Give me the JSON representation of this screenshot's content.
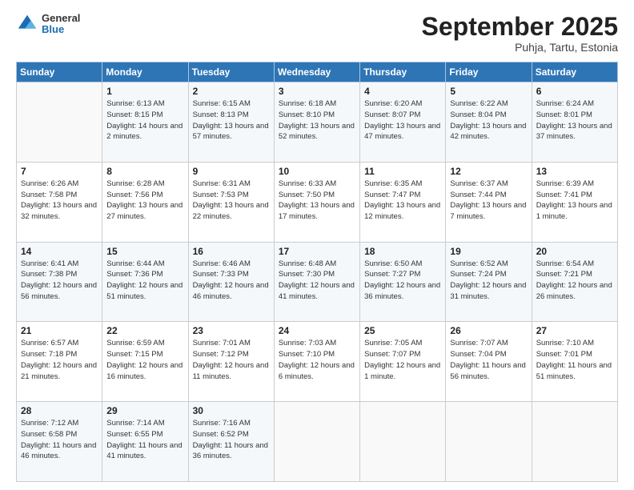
{
  "header": {
    "logo_general": "General",
    "logo_blue": "Blue",
    "month": "September 2025",
    "location": "Puhja, Tartu, Estonia"
  },
  "days_of_week": [
    "Sunday",
    "Monday",
    "Tuesday",
    "Wednesday",
    "Thursday",
    "Friday",
    "Saturday"
  ],
  "weeks": [
    [
      {
        "day": "",
        "sunrise": "",
        "sunset": "",
        "daylight": ""
      },
      {
        "day": "1",
        "sunrise": "Sunrise: 6:13 AM",
        "sunset": "Sunset: 8:15 PM",
        "daylight": "Daylight: 14 hours and 2 minutes."
      },
      {
        "day": "2",
        "sunrise": "Sunrise: 6:15 AM",
        "sunset": "Sunset: 8:13 PM",
        "daylight": "Daylight: 13 hours and 57 minutes."
      },
      {
        "day": "3",
        "sunrise": "Sunrise: 6:18 AM",
        "sunset": "Sunset: 8:10 PM",
        "daylight": "Daylight: 13 hours and 52 minutes."
      },
      {
        "day": "4",
        "sunrise": "Sunrise: 6:20 AM",
        "sunset": "Sunset: 8:07 PM",
        "daylight": "Daylight: 13 hours and 47 minutes."
      },
      {
        "day": "5",
        "sunrise": "Sunrise: 6:22 AM",
        "sunset": "Sunset: 8:04 PM",
        "daylight": "Daylight: 13 hours and 42 minutes."
      },
      {
        "day": "6",
        "sunrise": "Sunrise: 6:24 AM",
        "sunset": "Sunset: 8:01 PM",
        "daylight": "Daylight: 13 hours and 37 minutes."
      }
    ],
    [
      {
        "day": "7",
        "sunrise": "Sunrise: 6:26 AM",
        "sunset": "Sunset: 7:58 PM",
        "daylight": "Daylight: 13 hours and 32 minutes."
      },
      {
        "day": "8",
        "sunrise": "Sunrise: 6:28 AM",
        "sunset": "Sunset: 7:56 PM",
        "daylight": "Daylight: 13 hours and 27 minutes."
      },
      {
        "day": "9",
        "sunrise": "Sunrise: 6:31 AM",
        "sunset": "Sunset: 7:53 PM",
        "daylight": "Daylight: 13 hours and 22 minutes."
      },
      {
        "day": "10",
        "sunrise": "Sunrise: 6:33 AM",
        "sunset": "Sunset: 7:50 PM",
        "daylight": "Daylight: 13 hours and 17 minutes."
      },
      {
        "day": "11",
        "sunrise": "Sunrise: 6:35 AM",
        "sunset": "Sunset: 7:47 PM",
        "daylight": "Daylight: 13 hours and 12 minutes."
      },
      {
        "day": "12",
        "sunrise": "Sunrise: 6:37 AM",
        "sunset": "Sunset: 7:44 PM",
        "daylight": "Daylight: 13 hours and 7 minutes."
      },
      {
        "day": "13",
        "sunrise": "Sunrise: 6:39 AM",
        "sunset": "Sunset: 7:41 PM",
        "daylight": "Daylight: 13 hours and 1 minute."
      }
    ],
    [
      {
        "day": "14",
        "sunrise": "Sunrise: 6:41 AM",
        "sunset": "Sunset: 7:38 PM",
        "daylight": "Daylight: 12 hours and 56 minutes."
      },
      {
        "day": "15",
        "sunrise": "Sunrise: 6:44 AM",
        "sunset": "Sunset: 7:36 PM",
        "daylight": "Daylight: 12 hours and 51 minutes."
      },
      {
        "day": "16",
        "sunrise": "Sunrise: 6:46 AM",
        "sunset": "Sunset: 7:33 PM",
        "daylight": "Daylight: 12 hours and 46 minutes."
      },
      {
        "day": "17",
        "sunrise": "Sunrise: 6:48 AM",
        "sunset": "Sunset: 7:30 PM",
        "daylight": "Daylight: 12 hours and 41 minutes."
      },
      {
        "day": "18",
        "sunrise": "Sunrise: 6:50 AM",
        "sunset": "Sunset: 7:27 PM",
        "daylight": "Daylight: 12 hours and 36 minutes."
      },
      {
        "day": "19",
        "sunrise": "Sunrise: 6:52 AM",
        "sunset": "Sunset: 7:24 PM",
        "daylight": "Daylight: 12 hours and 31 minutes."
      },
      {
        "day": "20",
        "sunrise": "Sunrise: 6:54 AM",
        "sunset": "Sunset: 7:21 PM",
        "daylight": "Daylight: 12 hours and 26 minutes."
      }
    ],
    [
      {
        "day": "21",
        "sunrise": "Sunrise: 6:57 AM",
        "sunset": "Sunset: 7:18 PM",
        "daylight": "Daylight: 12 hours and 21 minutes."
      },
      {
        "day": "22",
        "sunrise": "Sunrise: 6:59 AM",
        "sunset": "Sunset: 7:15 PM",
        "daylight": "Daylight: 12 hours and 16 minutes."
      },
      {
        "day": "23",
        "sunrise": "Sunrise: 7:01 AM",
        "sunset": "Sunset: 7:12 PM",
        "daylight": "Daylight: 12 hours and 11 minutes."
      },
      {
        "day": "24",
        "sunrise": "Sunrise: 7:03 AM",
        "sunset": "Sunset: 7:10 PM",
        "daylight": "Daylight: 12 hours and 6 minutes."
      },
      {
        "day": "25",
        "sunrise": "Sunrise: 7:05 AM",
        "sunset": "Sunset: 7:07 PM",
        "daylight": "Daylight: 12 hours and 1 minute."
      },
      {
        "day": "26",
        "sunrise": "Sunrise: 7:07 AM",
        "sunset": "Sunset: 7:04 PM",
        "daylight": "Daylight: 11 hours and 56 minutes."
      },
      {
        "day": "27",
        "sunrise": "Sunrise: 7:10 AM",
        "sunset": "Sunset: 7:01 PM",
        "daylight": "Daylight: 11 hours and 51 minutes."
      }
    ],
    [
      {
        "day": "28",
        "sunrise": "Sunrise: 7:12 AM",
        "sunset": "Sunset: 6:58 PM",
        "daylight": "Daylight: 11 hours and 46 minutes."
      },
      {
        "day": "29",
        "sunrise": "Sunrise: 7:14 AM",
        "sunset": "Sunset: 6:55 PM",
        "daylight": "Daylight: 11 hours and 41 minutes."
      },
      {
        "day": "30",
        "sunrise": "Sunrise: 7:16 AM",
        "sunset": "Sunset: 6:52 PM",
        "daylight": "Daylight: 11 hours and 36 minutes."
      },
      {
        "day": "",
        "sunrise": "",
        "sunset": "",
        "daylight": ""
      },
      {
        "day": "",
        "sunrise": "",
        "sunset": "",
        "daylight": ""
      },
      {
        "day": "",
        "sunrise": "",
        "sunset": "",
        "daylight": ""
      },
      {
        "day": "",
        "sunrise": "",
        "sunset": "",
        "daylight": ""
      }
    ]
  ]
}
